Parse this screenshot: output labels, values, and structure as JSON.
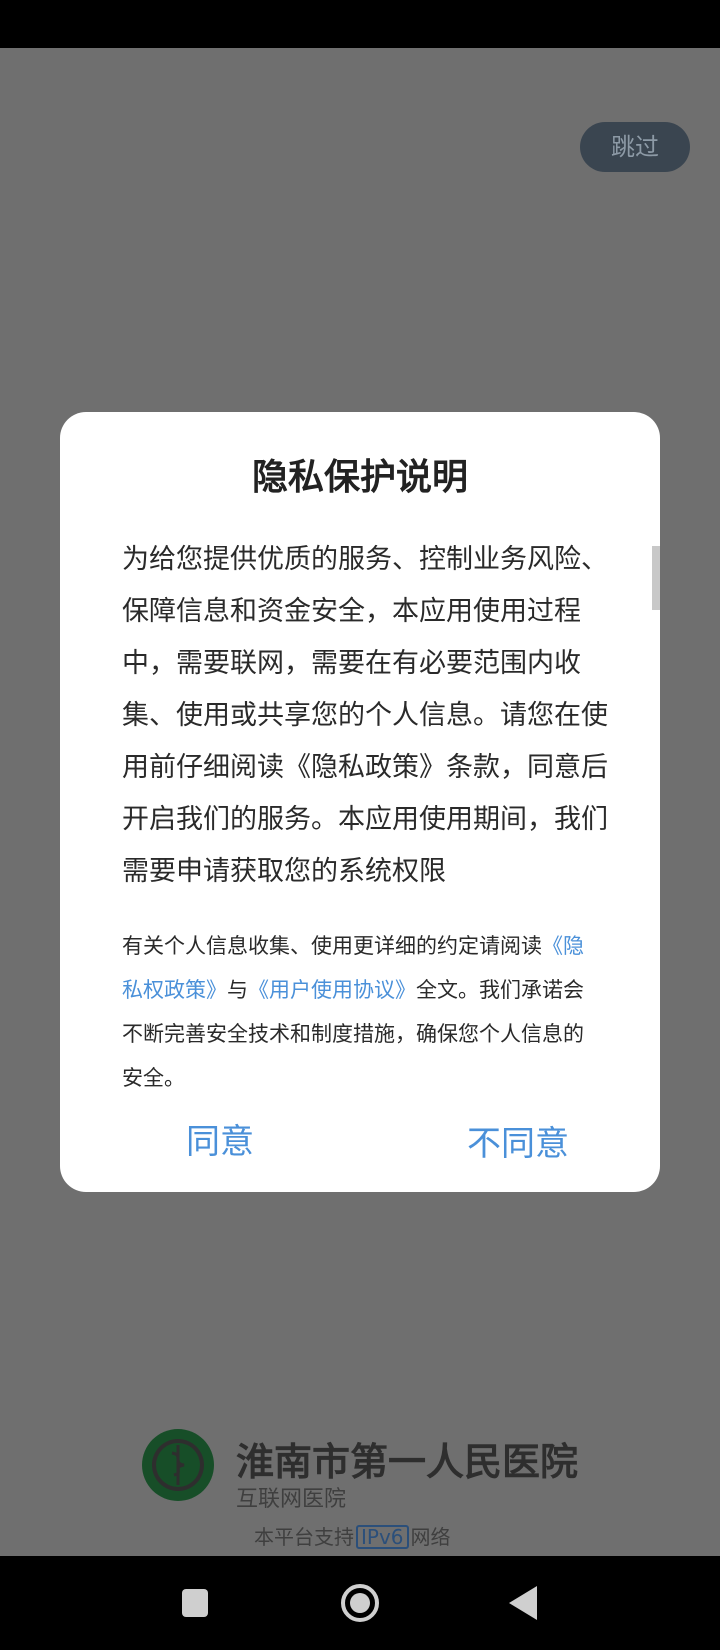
{
  "status_bar": {},
  "splash": {
    "skip_label": "跳过",
    "brand_name": "淮南市第一人民医院",
    "brand_sub": "互联网医院",
    "ipv6_prefix": "本平台支持",
    "ipv6_tag": "IPv6",
    "ipv6_suffix": "网络"
  },
  "dialog": {
    "title": "隐私保护说明",
    "body": "为给您提供优质的服务、控制业务风险、保障信息和资金安全，本应用使用过程中，需要联网，需要在有必要范围内收集、使用或共享您的个人信息。请您在使用前仔细阅读《隐私政策》条款，同意后开启我们的服务。本应用使用期间，我们需要申请获取您的系统权限",
    "note_prefix": "有关个人信息收集、使用更详细的约定请阅读",
    "privacy_link": "《隐私权政策》",
    "note_and": "与",
    "terms_link": "《用户使用协议》",
    "note_suffix": "全文。我们承诺会不断完善安全技术和制度措施，确保您个人信息的安全。",
    "agree_label": "同意",
    "disagree_label": "不同意"
  },
  "nav_bar": {
    "icons": [
      "recent-apps-icon",
      "home-icon",
      "back-icon"
    ]
  },
  "colors": {
    "overlay": "#6f6f6f",
    "link": "#4a90d9",
    "skip_bg": "#3a4550",
    "logo_green": "#1f7a3a"
  }
}
